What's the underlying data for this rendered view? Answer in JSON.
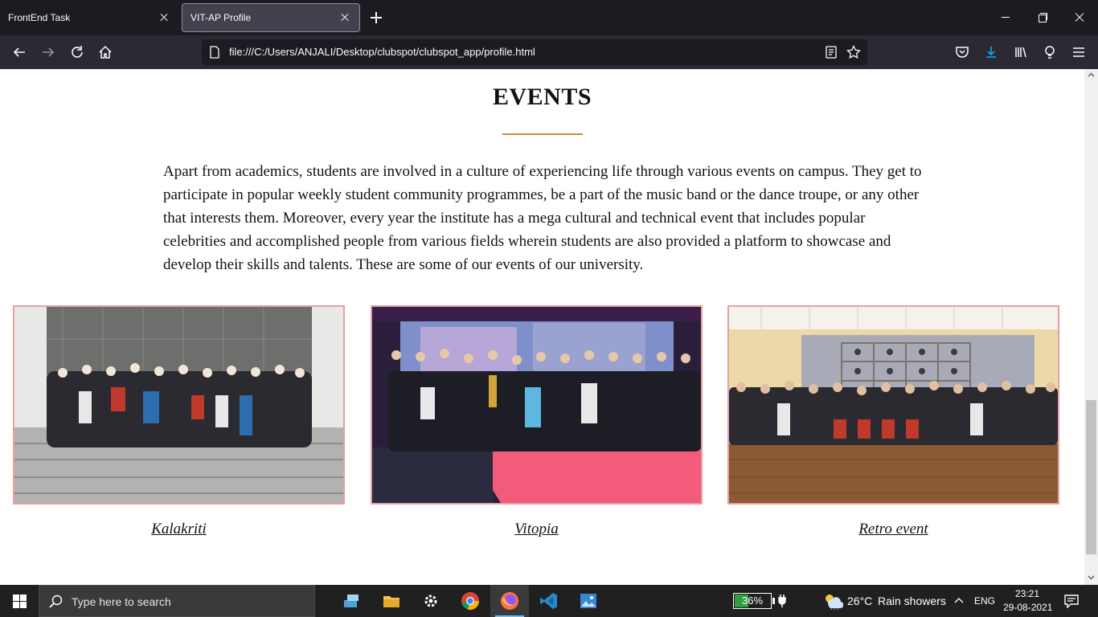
{
  "browser": {
    "tabs": [
      {
        "title": "FrontEnd Task",
        "active": false
      },
      {
        "title": "VIT-AP Profile",
        "active": true
      }
    ],
    "url": "file:///C:/Users/ANJALI/Desktop/clubspot/clubspot_app/profile.html",
    "accent_color": "#00b3f4"
  },
  "page": {
    "heading": "EVENTS",
    "underline_color": "#c98a3a",
    "description": "Apart from academics, students are involved in a culture of experiencing life through various events on campus. They get to participate in popular weekly student community programmes, be a part of the music band or the dance troupe, or any other that interests them. Moreover, every year the institute has a mega cultural and technical event that includes popular celebrities and accomplished people from various fields wherein students are also provided a platform to showcase and develop their skills and talents. These are some of our events of our university.",
    "events": [
      {
        "caption": "Kalakriti"
      },
      {
        "caption": "Vitopia"
      },
      {
        "caption": "Retro event"
      }
    ],
    "card_border_color": "#e4a0a4"
  },
  "taskbar": {
    "search_placeholder": "Type here to search",
    "battery_percent": 36,
    "battery_label": "36%",
    "weather_temp": "26°C",
    "weather_desc": "Rain showers",
    "language": "ENG",
    "time": "23:21",
    "date": "29-08-2021"
  }
}
